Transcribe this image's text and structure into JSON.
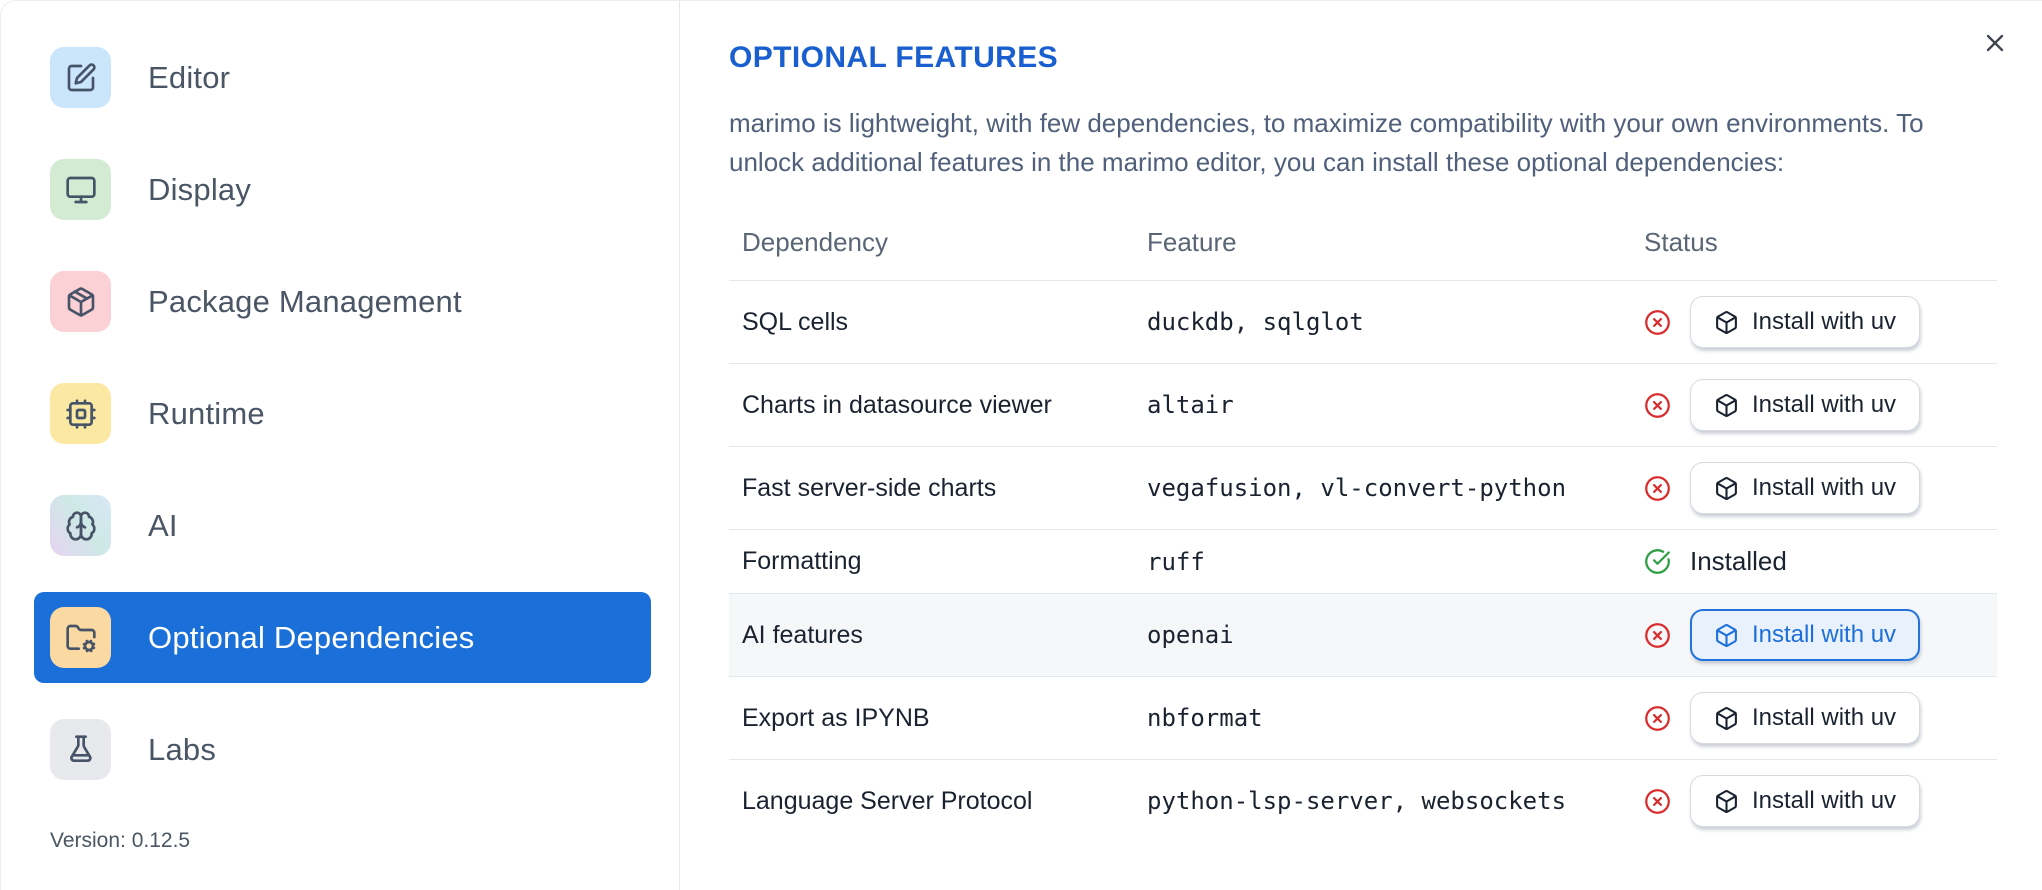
{
  "theme": {
    "accent_blue": "#1b6fd8",
    "title_blue": "#1a5fd0",
    "error_red": "#d92d2d",
    "success_green": "#2f9e44"
  },
  "sidebar": {
    "items": [
      {
        "id": "editor",
        "label": "Editor",
        "icon": "square-pen",
        "icon_bg": "#cbe5fa",
        "active": false
      },
      {
        "id": "display",
        "label": "Display",
        "icon": "monitor",
        "icon_bg": "#d3ebd3",
        "active": false
      },
      {
        "id": "package-management",
        "label": "Package Management",
        "icon": "package",
        "icon_bg": "#fbd1d5",
        "active": false
      },
      {
        "id": "runtime",
        "label": "Runtime",
        "icon": "cpu",
        "icon_bg": "#fbe8a2",
        "active": false
      },
      {
        "id": "ai",
        "label": "AI",
        "icon": "brain",
        "icon_bg": "linear-gradient(55deg, #e8d3f2 0%, #cde9e6 55%, #d9e7f6 100%)",
        "active": false
      },
      {
        "id": "optional-dependencies",
        "label": "Optional Dependencies",
        "icon": "folder-cog",
        "icon_bg": "#fbd9a3",
        "active": true
      },
      {
        "id": "labs",
        "label": "Labs",
        "icon": "flask",
        "icon_bg": "#e8e9ec",
        "active": false
      }
    ],
    "version": "Version: 0.12.5"
  },
  "main": {
    "title": "OPTIONAL FEATURES",
    "description": "marimo is lightweight, with few dependencies, to maximize compatibility with your own environments. To unlock additional features in the marimo editor, you can install these optional dependencies:",
    "table": {
      "headers": [
        "Dependency",
        "Feature",
        "Status"
      ],
      "rows": [
        {
          "dependency": "SQL cells",
          "feature": "duckdb, sqlglot",
          "installed": false,
          "focused": false,
          "action_label": "Install with uv"
        },
        {
          "dependency": "Charts in datasource viewer",
          "feature": "altair",
          "installed": false,
          "focused": false,
          "action_label": "Install with uv"
        },
        {
          "dependency": "Fast server-side charts",
          "feature": "vegafusion, vl-convert-python",
          "installed": false,
          "focused": false,
          "action_label": "Install with uv"
        },
        {
          "dependency": "Formatting",
          "feature": "ruff",
          "installed": true,
          "focused": false,
          "status_label": "Installed"
        },
        {
          "dependency": "AI features",
          "feature": "openai",
          "installed": false,
          "focused": true,
          "action_label": "Install with uv"
        },
        {
          "dependency": "Export as IPYNB",
          "feature": "nbformat",
          "installed": false,
          "focused": false,
          "action_label": "Install with uv"
        },
        {
          "dependency": "Language Server Protocol",
          "feature": "python-lsp-server, websockets",
          "installed": false,
          "focused": false,
          "action_label": "Install with uv"
        }
      ]
    }
  }
}
